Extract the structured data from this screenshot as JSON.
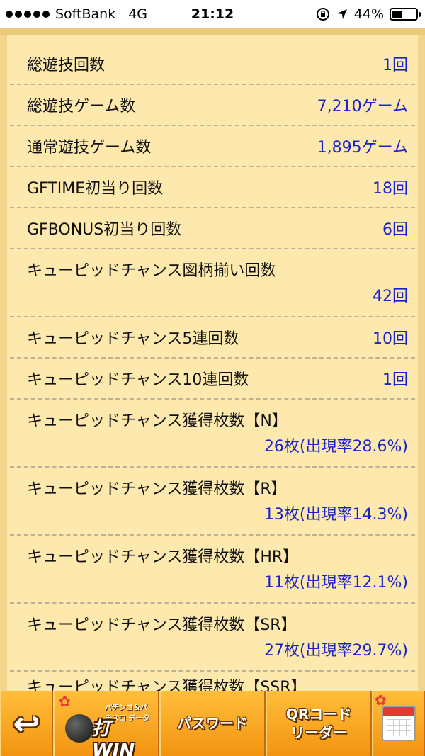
{
  "status_bar": {
    "carrier": "SoftBank",
    "network": "4G",
    "time": "21:12",
    "battery": "44%",
    "battery_level": 0.44,
    "icons": [
      "signal-dots-icon",
      "orientation-lock-icon",
      "location-arrow-icon",
      "battery-icon"
    ]
  },
  "stats": [
    {
      "label": "総遊技回数",
      "value": "1回"
    },
    {
      "label": "総遊技ゲーム数",
      "value": "7,210ゲーム"
    },
    {
      "label": "通常遊技ゲーム数",
      "value": "1,895ゲーム"
    },
    {
      "label": "GFTIME初当り回数",
      "value": "18回"
    },
    {
      "label": "GFBONUS初当り回数",
      "value": "6回"
    },
    {
      "label": "キューピッドチャンス図柄揃い回数",
      "value": "42回"
    },
    {
      "label": "キューピッドチャンス5連回数",
      "value": "10回"
    },
    {
      "label": "キューピッドチャンス10連回数",
      "value": "1回"
    },
    {
      "label": "キューピッドチャンス獲得枚数【N】",
      "value": "26枚(出現率28.6%)"
    },
    {
      "label": "キューピッドチャンス獲得枚数【R】",
      "value": "13枚(出現率14.3%)"
    },
    {
      "label": "キューピッドチャンス獲得枚数【HR】",
      "value": "11枚(出現率12.1%)"
    },
    {
      "label": "キューピッドチャンス獲得枚数【SR】",
      "value": "27枚(出現率29.7%)"
    },
    {
      "label": "キューピッドチャンス獲得枚数【SSR】",
      "value": ""
    }
  ],
  "toolbar": {
    "back_icon": "back-arrow-icon",
    "logo_text": "打WIN",
    "logo_sub": "パチンコ＆パチスロ データ",
    "password_label": "パスワード",
    "qr_label_line1": "QRコード",
    "qr_label_line2": "リーダー",
    "calendar_icon": "calendar-icon",
    "flower_icon": "plum-flower-icon"
  },
  "colors": {
    "value_text": "#1a23c9",
    "background": "#fde9ad",
    "toolbar": "#f39411"
  }
}
